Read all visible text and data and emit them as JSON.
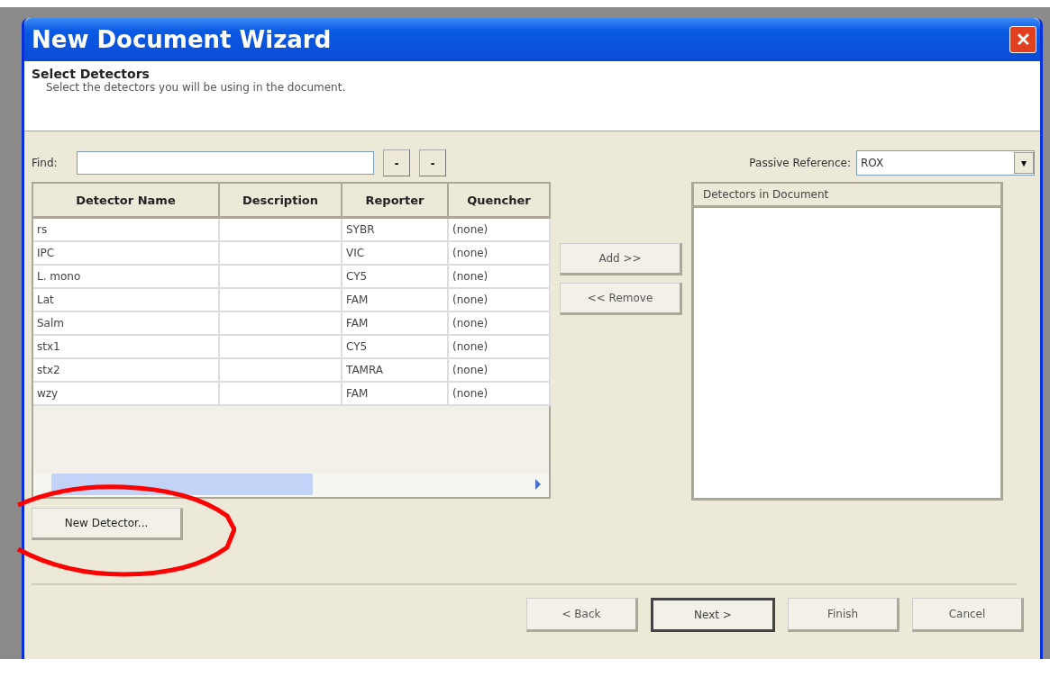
{
  "window": {
    "title": "New Document Wizard",
    "close": "✕"
  },
  "header": {
    "title": "Select Detectors",
    "subtitle": "Select the detectors you will be using in the document."
  },
  "find": {
    "label": "Find:",
    "buttons": [
      "-",
      "-"
    ]
  },
  "passive_reference": {
    "label": "Passive Reference:",
    "value": "ROX",
    "arrow": "▾"
  },
  "table": {
    "columns": [
      "Detector Name",
      "Description",
      "Reporter",
      "Quencher"
    ],
    "rows": [
      [
        "rs",
        "",
        "SYBR",
        "(none)"
      ],
      [
        "IPC",
        "",
        "VIC",
        "(none)"
      ],
      [
        "L. mono",
        "",
        "CY5",
        "(none)"
      ],
      [
        "Lat",
        "",
        "FAM",
        "(none)"
      ],
      [
        "Salm",
        "",
        "FAM",
        "(none)"
      ],
      [
        "stx1",
        "",
        "CY5",
        "(none)"
      ],
      [
        "stx2",
        "",
        "TAMRA",
        "(none)"
      ],
      [
        "wzy",
        "",
        "FAM",
        "(none)"
      ]
    ]
  },
  "middle_buttons": [
    "Add >>",
    "<< Remove"
  ],
  "document_list": {
    "header": "Detectors in Document"
  },
  "new_detector": "New Detector...",
  "annotation": {
    "kind": "ellipse",
    "color": "#ff0000"
  },
  "footer_buttons": [
    {
      "label": "< Back",
      "selected": false
    },
    {
      "label": "Next >",
      "selected": true
    },
    {
      "label": "Finish",
      "selected": false
    },
    {
      "label": "Cancel",
      "selected": false
    }
  ]
}
